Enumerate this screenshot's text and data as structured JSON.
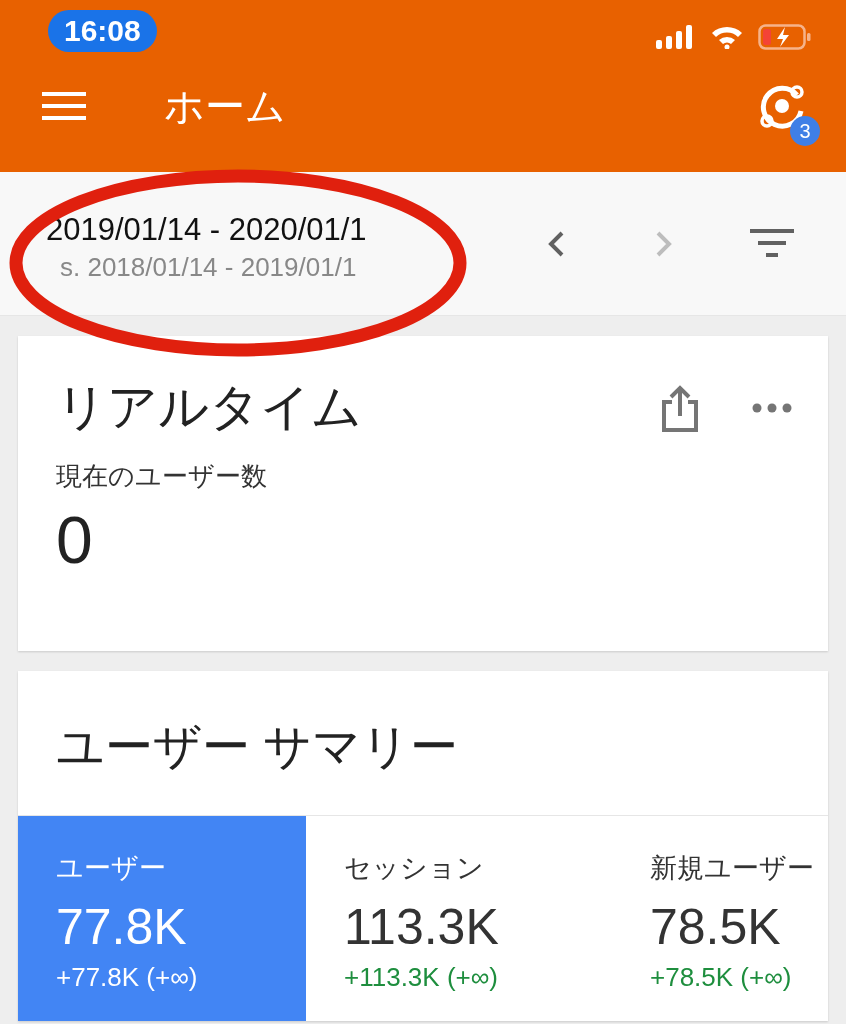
{
  "status_bar": {
    "time": "16:08"
  },
  "app_bar": {
    "title": "ホーム",
    "notification_count": "3"
  },
  "date_range": {
    "primary": "2019/01/14 - 2020/01/1",
    "comparison": "s. 2018/01/14 - 2019/01/1",
    "prev_disabled": false,
    "next_disabled": true
  },
  "realtime_card": {
    "title": "リアルタイム",
    "metric_label": "現在のユーザー数",
    "value": "0"
  },
  "summary_card": {
    "title": "ユーザー サマリー",
    "metrics": [
      {
        "label": "ユーザー",
        "value": "77.8K",
        "change": "+77.8K (+∞)",
        "selected": true
      },
      {
        "label": "セッション",
        "value": "113.3K",
        "change": "+113.3K (+∞)",
        "selected": false
      },
      {
        "label": "新規ユーザー",
        "value": "78.5K",
        "change": "+78.5K (+∞)",
        "selected": false
      }
    ]
  }
}
